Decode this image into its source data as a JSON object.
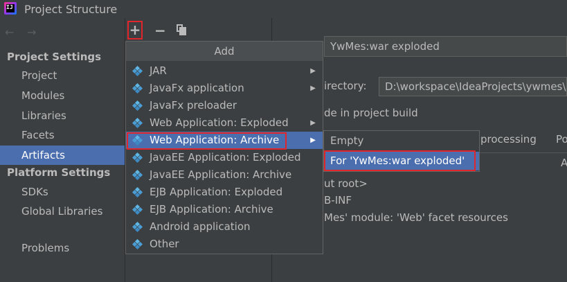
{
  "window": {
    "title": "Project Structure",
    "icon": "intellij-app-icon"
  },
  "nav": {
    "back": "←",
    "forward": "→",
    "project_settings_heading": "Project Settings",
    "project_settings_items": [
      "Project",
      "Modules",
      "Libraries",
      "Facets",
      "Artifacts"
    ],
    "platform_settings_heading": "Platform Settings",
    "platform_settings_items": [
      "SDKs",
      "Global Libraries"
    ],
    "problems": "Problems",
    "selected": "Artifacts"
  },
  "toolbar": {
    "add": "+",
    "remove": "−",
    "copy": "copy-icon"
  },
  "popup": {
    "title": "Add",
    "items": [
      {
        "label": "JAR",
        "has_submenu": true
      },
      {
        "label": "JavaFx application",
        "has_submenu": true
      },
      {
        "label": "JavaFx preloader",
        "has_submenu": false
      },
      {
        "label": "Web Application: Exploded",
        "has_submenu": true
      },
      {
        "label": "Web Application: Archive",
        "has_submenu": true,
        "selected": true
      },
      {
        "label": "JavaEE Application: Exploded",
        "has_submenu": false
      },
      {
        "label": "JavaEE Application: Archive",
        "has_submenu": false
      },
      {
        "label": "EJB Application: Exploded",
        "has_submenu": false
      },
      {
        "label": "EJB Application: Archive",
        "has_submenu": false
      },
      {
        "label": "Android application",
        "has_submenu": false
      },
      {
        "label": "Other",
        "has_submenu": false
      }
    ],
    "submenu_arrow": "▶"
  },
  "submenu": {
    "items": [
      "Empty",
      "For 'YwMes:war exploded'"
    ],
    "selected": "For 'YwMes:war exploded'"
  },
  "artifact": {
    "name": "YwMes:war exploded",
    "directory_label": "irectory:",
    "directory_value": "D:\\workspace\\IdeaProjects\\ywmes\\o",
    "build_text": "de in project build",
    "tab_processing": "processing",
    "tab_po": "Po",
    "right_a": "A",
    "tree_lines": [
      "ut root>",
      "B-INF",
      "Mes' module: 'Web' facet resources"
    ]
  },
  "colors": {
    "background": "#3c3f41",
    "selection": "#4b6eaf",
    "highlight_box": "#e0262b",
    "text": "#bbbbbb"
  }
}
